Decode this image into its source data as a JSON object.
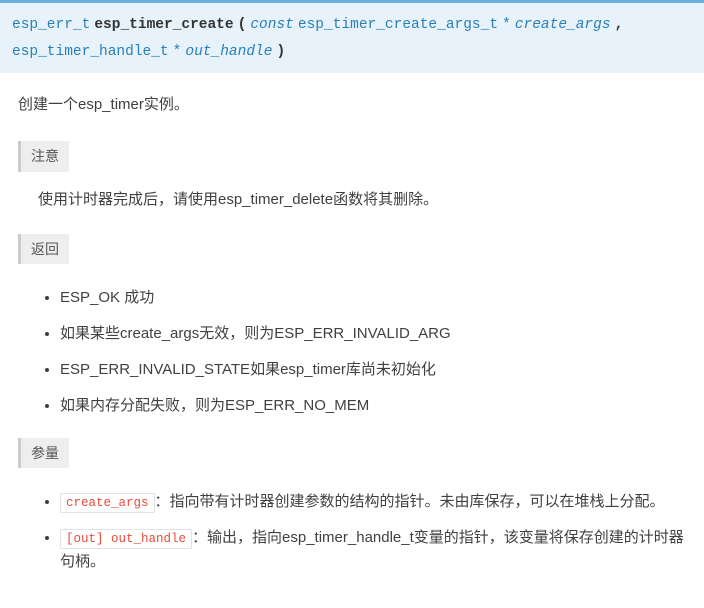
{
  "signature": {
    "return_type": "esp_err_t",
    "fn_name": "esp_timer_create",
    "open": "(",
    "const_kw": "const",
    "arg1_type": "esp_timer_create_args_t",
    "star1": "*",
    "arg1_name": "create_args",
    "comma": ",",
    "arg2_type": "esp_timer_handle_t",
    "star2": "*",
    "arg2_name": "out_handle",
    "close": ")"
  },
  "description": "创建一个esp_timer实例。",
  "sections": {
    "note_label": "注意",
    "note_text": "使用计时器完成后，请使用esp_timer_delete函数将其删除。",
    "return_label": "返回",
    "returns": [
      "ESP_OK 成功",
      "如果某些create_args无效，则为ESP_ERR_INVALID_ARG",
      "ESP_ERR_INVALID_STATE如果esp_timer库尚未初始化",
      "如果内存分配失败，则为ESP_ERR_NO_MEM"
    ],
    "params_label": "参量",
    "params": [
      {
        "code": "create_args",
        "text": "：指向带有计时器创建参数的结构的指针。未由库保存，可以在堆栈上分配。"
      },
      {
        "code": "[out] out_handle",
        "text": "：输出，指向esp_timer_handle_t变量的指针，该变量将保存创建的计时器句柄。"
      }
    ]
  }
}
